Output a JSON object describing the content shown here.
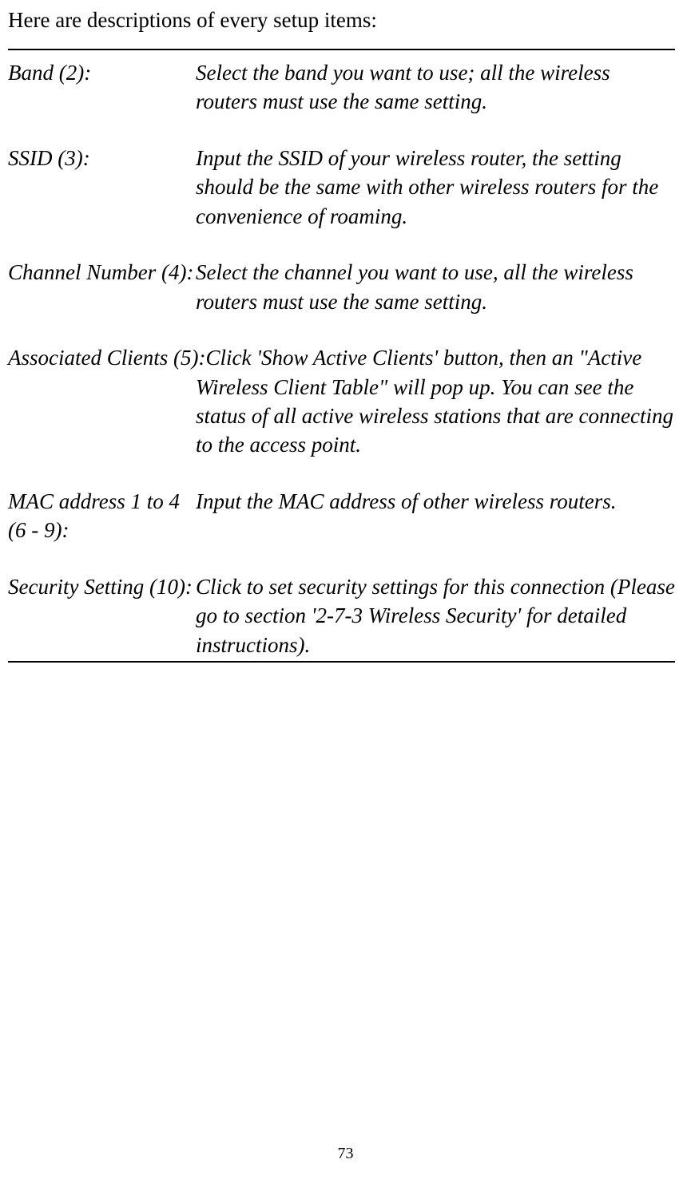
{
  "intro": "Here are descriptions of every setup items:",
  "items": [
    {
      "label": "Band (2):",
      "desc": "Select the band you want to use; all the wireless routers must use the same setting."
    },
    {
      "label": "SSID (3):",
      "desc": "Input the SSID of your wireless router, the setting should be the same with other wireless routers for the convenience of roaming."
    },
    {
      "label": "Channel Number (4):",
      "desc": "Select the channel you want to use, all the wireless routers must use the same setting."
    },
    {
      "label": "Associated Clients (5):",
      "desc_first": "Click 'Show Active Clients' button, then an \"Active",
      "desc_rest": "Wireless Client Table\" will pop up. You can see the status of all active wireless stations that are connecting to the access point."
    },
    {
      "label": "MAC address 1 to 4 (6 - 9):",
      "desc": "Input the MAC address of other wireless routers."
    },
    {
      "label": "Security Setting (10):",
      "desc": "Click to set security settings for this connection (Please go to section '2-7-3 Wireless Security' for detailed instructions)."
    }
  ],
  "pageNumber": "73"
}
